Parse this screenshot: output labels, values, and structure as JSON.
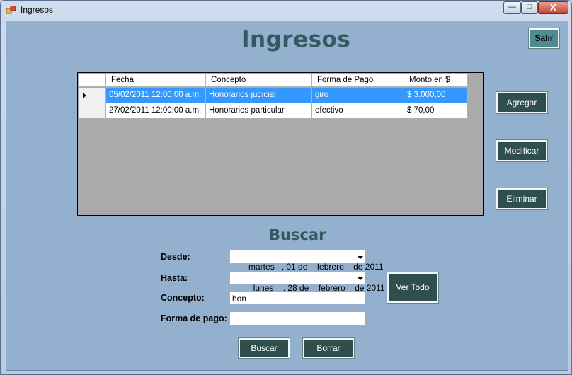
{
  "window": {
    "title": "Ingresos",
    "controls": {
      "minimize": "—",
      "maximize": "□",
      "close": "X"
    }
  },
  "heading": "Ingresos",
  "buttons": {
    "salir": "Salir",
    "agregar": "Agregar",
    "modificar": "Modificar",
    "eliminar": "Eliminar",
    "ver_todo": "Ver Todo",
    "buscar": "Buscar",
    "borrar": "Borrar"
  },
  "grid": {
    "columns": [
      "Fecha",
      "Concepto",
      "Forma de Pago",
      "Monto en $"
    ],
    "rows": [
      [
        "05/02/2011 12:00:00 a.m.",
        "Honorarios judicial",
        "giro",
        "$ 3.000,00"
      ],
      [
        "27/02/2011 12:00:00 a.m.",
        "Honorarios particular",
        "efectivo",
        "$ 70,00"
      ]
    ],
    "selected_row": 0
  },
  "search": {
    "title": "Buscar",
    "desde_label": "Desde:",
    "desde_value": "martes   , 01 de    febrero    de 2011",
    "hasta_label": "Hasta:",
    "hasta_value": "  lunes    , 28 de    febrero    de 2011",
    "concepto_label": "Concepto:",
    "concepto_value": "hon",
    "forma_pago_label": "Forma de pago:",
    "forma_pago_value": ""
  }
}
